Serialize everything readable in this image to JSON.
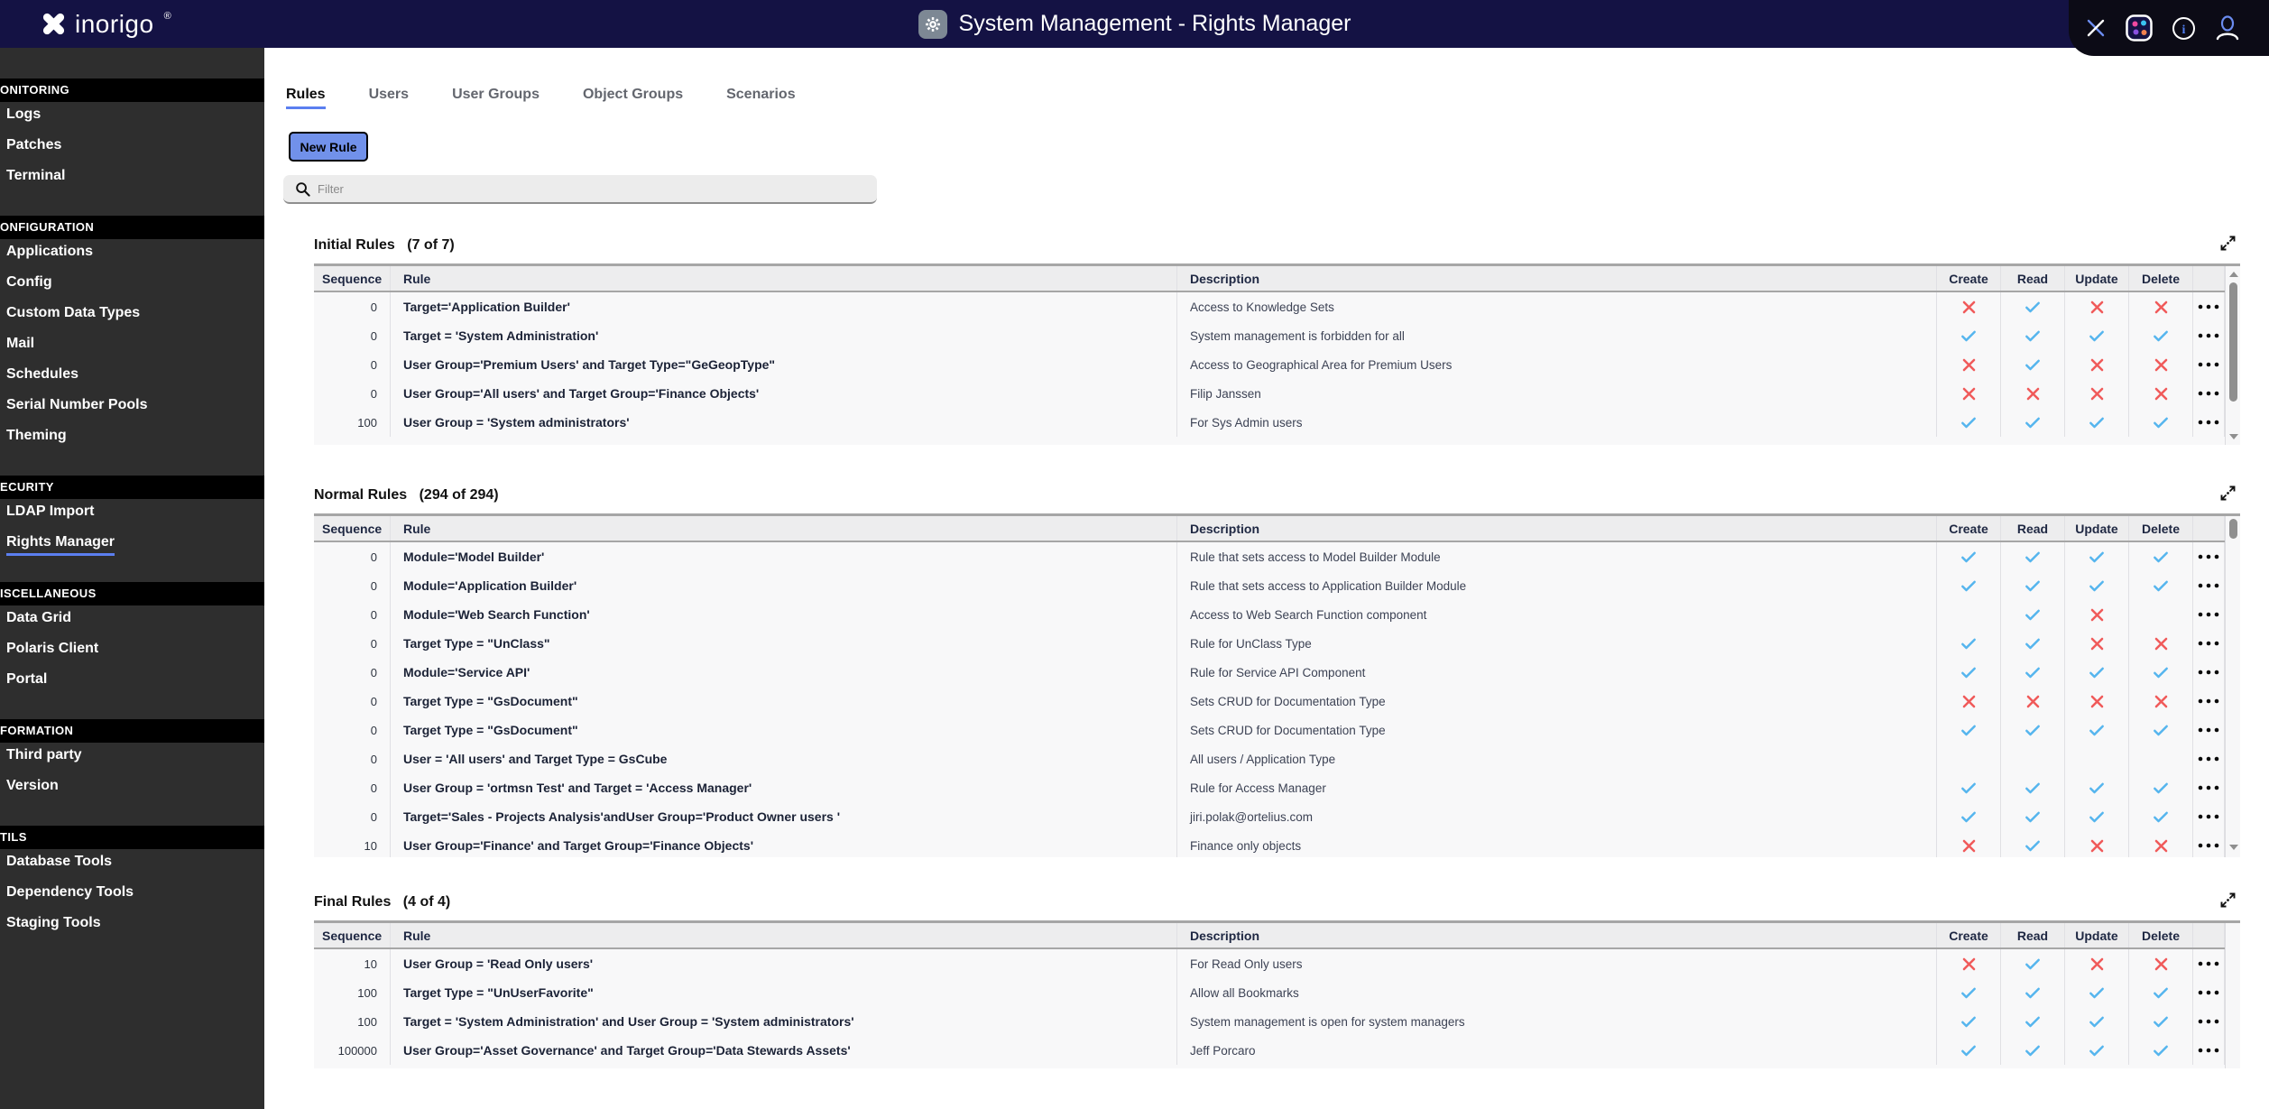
{
  "topbar": {
    "logo": "inorigo",
    "registered": "®",
    "title": "System Management - Rights Manager",
    "icons": [
      "x-logo-icon",
      "gear-icon",
      "close-icon",
      "app-launcher-icon",
      "info-icon",
      "user-icon"
    ]
  },
  "sidebar": {
    "sections": [
      {
        "label": "ONITORING",
        "items": [
          "Logs",
          "Patches",
          "Terminal"
        ]
      },
      {
        "label": "ONFIGURATION",
        "items": [
          "Applications",
          "Config",
          "Custom Data Types",
          "Mail",
          "Schedules",
          "Serial Number Pools",
          "Theming"
        ]
      },
      {
        "label": "ECURITY",
        "items": [
          "LDAP Import",
          "Rights Manager"
        ],
        "active_item": "Rights Manager"
      },
      {
        "label": "ISCELLANEOUS",
        "items": [
          "Data Grid",
          "Polaris Client",
          "Portal"
        ]
      },
      {
        "label": "FORMATION",
        "items": [
          "Third party",
          "Version"
        ]
      },
      {
        "label": "TILS",
        "items": [
          "Database Tools",
          "Dependency Tools",
          "Staging Tools"
        ]
      }
    ]
  },
  "tabs": [
    {
      "label": "Rules",
      "active": true
    },
    {
      "label": "Users",
      "active": false
    },
    {
      "label": "User Groups",
      "active": false
    },
    {
      "label": "Object Groups",
      "active": false
    },
    {
      "label": "Scenarios",
      "active": false
    }
  ],
  "toolbar": {
    "new_rule": "New Rule",
    "filter_placeholder": "Filter"
  },
  "table_columns": {
    "sequence": "Sequence",
    "rule": "Rule",
    "description": "Description",
    "create": "Create",
    "read": "Read",
    "update": "Update",
    "delete": "Delete"
  },
  "rule_sections": [
    {
      "title": "Initial Rules",
      "count": "(7 of 7)",
      "rows": [
        {
          "sequence": "0",
          "rule": "Target='Application Builder'",
          "description": "Access to Knowledge Sets",
          "crud": [
            "cross",
            "check",
            "cross",
            "cross"
          ]
        },
        {
          "sequence": "0",
          "rule": "Target = 'System Administration'",
          "description": "System management is forbidden for all",
          "crud": [
            "check",
            "check",
            "check",
            "check"
          ]
        },
        {
          "sequence": "0",
          "rule": "User Group='Premium Users' and Target Type=\"GeGeopType\"",
          "description": "Access to Geographical Area for Premium Users",
          "crud": [
            "cross",
            "check",
            "cross",
            "cross"
          ]
        },
        {
          "sequence": "0",
          "rule": "User Group='All users' and Target Group='Finance Objects'",
          "description": "Filip Janssen",
          "crud": [
            "cross",
            "cross",
            "cross",
            "cross"
          ]
        },
        {
          "sequence": "100",
          "rule": "User Group = 'System administrators'",
          "description": "For Sys Admin users",
          "crud": [
            "check",
            "check",
            "check",
            "check"
          ]
        }
      ]
    },
    {
      "title": "Normal Rules",
      "count": "(294 of 294)",
      "rows": [
        {
          "sequence": "0",
          "rule": "Module='Model Builder'",
          "description": "Rule that sets access to Model Builder Module",
          "crud": [
            "check",
            "check",
            "check",
            "check"
          ]
        },
        {
          "sequence": "0",
          "rule": "Module='Application Builder'",
          "description": "Rule that sets access to Application Builder Module",
          "crud": [
            "check",
            "check",
            "check",
            "check"
          ]
        },
        {
          "sequence": "0",
          "rule": "Module='Web Search Function'",
          "description": "Access to Web Search Function component",
          "crud": [
            "",
            "check",
            "cross",
            ""
          ]
        },
        {
          "sequence": "0",
          "rule": "Target Type = \"UnClass\"",
          "description": "Rule for UnClass Type",
          "crud": [
            "check",
            "check",
            "cross",
            "cross"
          ]
        },
        {
          "sequence": "0",
          "rule": "Module='Service API'",
          "description": "Rule for Service API Component",
          "crud": [
            "check",
            "check",
            "check",
            "check"
          ]
        },
        {
          "sequence": "0",
          "rule": "Target Type = \"GsDocument\"",
          "description": "Sets CRUD for Documentation Type",
          "crud": [
            "cross",
            "cross",
            "cross",
            "cross"
          ]
        },
        {
          "sequence": "0",
          "rule": "Target Type = \"GsDocument\"",
          "description": "Sets CRUD for Documentation Type",
          "crud": [
            "check",
            "check",
            "check",
            "check"
          ]
        },
        {
          "sequence": "0",
          "rule": "User = 'All users' and Target Type = GsCube",
          "description": "All users / Application Type",
          "crud": [
            "",
            "",
            "",
            ""
          ]
        },
        {
          "sequence": "0",
          "rule": "User Group = 'ortmsn Test' and Target = 'Access Manager'",
          "description": "Rule for Access Manager",
          "crud": [
            "check",
            "check",
            "check",
            "check"
          ]
        },
        {
          "sequence": "0",
          "rule": "Target='Sales - Projects Analysis'andUser Group='Product Owner users '",
          "description": "jiri.polak@ortelius.com",
          "crud": [
            "check",
            "check",
            "check",
            "check"
          ]
        },
        {
          "sequence": "10",
          "rule": "User Group='Finance' and Target Group='Finance Objects'",
          "description": "Finance only objects",
          "crud": [
            "cross",
            "check",
            "cross",
            "cross"
          ]
        }
      ]
    },
    {
      "title": "Final Rules",
      "count": "(4 of 4)",
      "rows": [
        {
          "sequence": "10",
          "rule": "User Group = 'Read Only users'",
          "description": "For Read Only users",
          "crud": [
            "cross",
            "check",
            "cross",
            "cross"
          ]
        },
        {
          "sequence": "100",
          "rule": "Target Type = \"UnUserFavorite\"",
          "description": "Allow all Bookmarks",
          "crud": [
            "check",
            "check",
            "check",
            "check"
          ]
        },
        {
          "sequence": "100",
          "rule": "Target = 'System Administration' and User Group = 'System administrators'",
          "description": "System management is open for system managers",
          "crud": [
            "check",
            "check",
            "check",
            "check"
          ]
        },
        {
          "sequence": "100000",
          "rule": "User Group='Asset Governance' and Target Group='Data Stewards Assets'",
          "description": "Jeff Porcaro",
          "crud": [
            "check",
            "check",
            "check",
            "check"
          ]
        }
      ]
    }
  ],
  "colors": {
    "accent": "#5b7ff0",
    "check": "#55b5ee",
    "cross": "#f05a5a",
    "topbar_bg": "#141244",
    "button_bg": "#7191ea"
  }
}
